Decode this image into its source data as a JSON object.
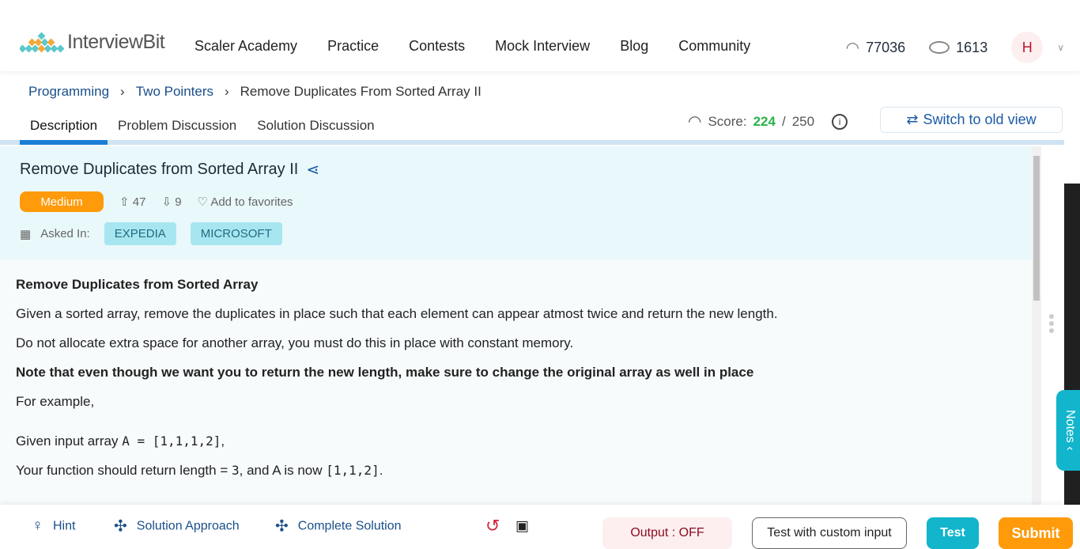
{
  "nav": {
    "logo": "InterviewBit",
    "links": [
      "Scaler Academy",
      "Practice",
      "Contests",
      "Mock Interview",
      "Blog",
      "Community"
    ],
    "speed_score": "77036",
    "coins": "1613",
    "avatar": "H"
  },
  "breadcrumb": [
    "Programming",
    "Two Pointers",
    "Remove Duplicates From Sorted Array II"
  ],
  "tabs": [
    "Description",
    "Problem Discussion",
    "Solution Discussion"
  ],
  "score": {
    "label": "Score:",
    "value": "224",
    "sep": "/",
    "max": "250"
  },
  "switch_label": "Switch to old view",
  "problem": {
    "title": "Remove Duplicates from Sorted Array II",
    "difficulty": "Medium",
    "upvotes": "47",
    "downvotes": "9",
    "favorites": "Add to favorites",
    "asked_in": "Asked In:",
    "companies": [
      "EXPEDIA",
      "MICROSOFT"
    ]
  },
  "body": {
    "heading": "Remove Duplicates from Sorted Array",
    "p1": "Given a sorted array, remove the duplicates in place such that each element can appear atmost twice and return the new length.",
    "p2": "Do not allocate extra space for another array, you must do this in place with constant memory.",
    "note": "Note that even though we want you to return the new length, make sure to change the original array as well in place",
    "p3": "For example,",
    "ex1_pre": "Given input array ",
    "ex1_code": "A = [1,1,1,2]",
    "ex1_post": ",",
    "ex2_pre": "Your function should return length = ",
    "ex2_len": "3",
    "ex2_mid": ", and A is now ",
    "ex2_code": "[1,1,2]",
    "ex2_post": "."
  },
  "notes": "Notes ‹",
  "bottom": {
    "hint": "Hint",
    "approach": "Solution Approach",
    "complete": "Complete Solution",
    "output": "Output : OFF",
    "custom": "Test with custom input",
    "test": "Test",
    "submit": "Submit"
  },
  "colors": {
    "accent": "#1a7fd4",
    "medium": "#ff9a0b",
    "test": "#12b5cb",
    "submit": "#ff9a0b"
  }
}
